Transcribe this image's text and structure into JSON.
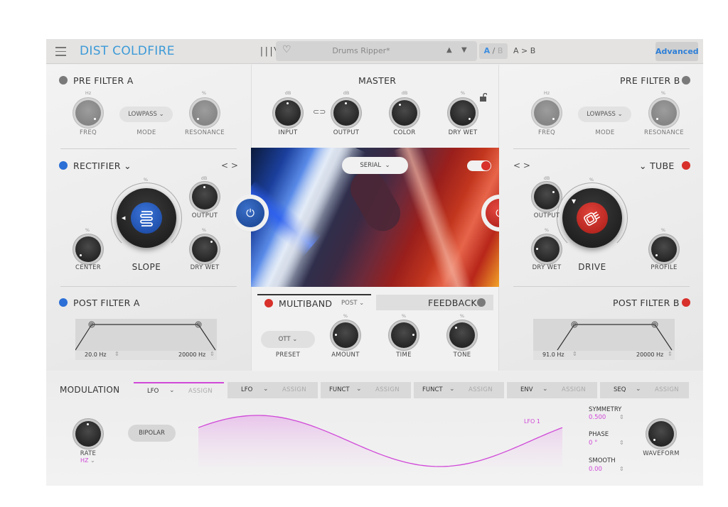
{
  "app": {
    "title": "DIST COLDFIRE"
  },
  "topbar": {
    "library_icon": "|||\\",
    "heart_icon": "♡",
    "preset_name": "Drums Ripper*",
    "prev_icon": "▲",
    "next_icon": "▼",
    "ab": {
      "a": "A",
      "sep": "/",
      "b": "B"
    },
    "a_to_b": "A > B",
    "advanced_label": "Advanced"
  },
  "pre_filter_a": {
    "title": "PRE FILTER A",
    "led": "grey",
    "freq": {
      "unit": "Hz",
      "label": "FREQ"
    },
    "mode": {
      "value": "LOWPASS",
      "label": "MODE"
    },
    "resonance": {
      "unit": "%",
      "label": "RESONANCE"
    }
  },
  "pre_filter_b": {
    "title": "PRE FILTER B",
    "led": "grey",
    "freq": {
      "unit": "Hz",
      "label": "FREQ"
    },
    "mode": {
      "value": "LOWPASS",
      "label": "MODE"
    },
    "resonance": {
      "unit": "%",
      "label": "RESONANCE"
    }
  },
  "master": {
    "title": "MASTER",
    "knobs": [
      {
        "unit": "dB",
        "label": "INPUT"
      },
      {
        "unit": "dB",
        "label": "OUTPUT"
      },
      {
        "unit": "dB",
        "label": "COLOR"
      },
      {
        "unit": "%",
        "label": "DRY  WET"
      }
    ],
    "link_icon": "⊂⊃",
    "lock_icon": "unlocked"
  },
  "dist_a": {
    "type": "RECTIFIER",
    "led": "blue",
    "nav": "< >",
    "slope": {
      "unit": "%",
      "label": "SLOPE"
    },
    "output": {
      "unit": "dB",
      "label": "OUTPUT"
    },
    "center": {
      "unit": "%",
      "label": "CENTER"
    },
    "drywet": {
      "unit": "%",
      "label": "DRY WET"
    }
  },
  "dist_b": {
    "type": "TUBE",
    "led": "red",
    "nav": "< >",
    "drive": {
      "unit": "%",
      "label": "DRIVE"
    },
    "output": {
      "unit": "dB",
      "label": "OUTPUT"
    },
    "drywet": {
      "unit": "%",
      "label": "DRY WET"
    },
    "profile": {
      "unit": "%",
      "label": "PROFILE"
    }
  },
  "routing": {
    "mode": "SERIAL",
    "chevron": "⌄"
  },
  "post_filter_a": {
    "title": "POST FILTER A",
    "led": "blue",
    "low": "20.0 Hz",
    "high": "20000 Hz"
  },
  "post_filter_b": {
    "title": "POST FILTER B",
    "led": "red",
    "low": "91.0 Hz",
    "high": "20000 Hz"
  },
  "multiband": {
    "title": "MULTIBAND",
    "position": "POST",
    "preset": {
      "value": "OTT",
      "label": "PRESET"
    },
    "amount": {
      "unit": "%",
      "label": "AMOUNT"
    },
    "time": {
      "unit": "%",
      "label": "TIME"
    },
    "tone": {
      "unit": "%",
      "label": "TONE"
    }
  },
  "feedback": {
    "title": "FEEDBACK"
  },
  "modulation": {
    "title": "MODULATION",
    "tabs": [
      {
        "type": "LFO",
        "assign": "ASSIGN",
        "active": true
      },
      {
        "type": "LFO",
        "assign": "ASSIGN",
        "active": false
      },
      {
        "type": "FUNCT",
        "assign": "ASSIGN",
        "active": false
      },
      {
        "type": "FUNCT",
        "assign": "ASSIGN",
        "active": false
      },
      {
        "type": "ENV",
        "assign": "ASSIGN",
        "active": false
      },
      {
        "type": "SEQ",
        "assign": "ASSIGN",
        "active": false
      }
    ],
    "rate": {
      "label": "RATE",
      "unit": "HZ"
    },
    "bipolar_label": "BIPOLAR",
    "lfo_name": "LFO 1",
    "symmetry": {
      "label": "SYMMETRY",
      "value": "0.500"
    },
    "phase": {
      "label": "PHASE",
      "value": "0 °"
    },
    "smooth": {
      "label": "SMOOTH",
      "value": "0.00"
    },
    "waveform_label": "WAVEFORM"
  },
  "colors": {
    "accent_blue": "#3d9ad8",
    "dist_a": "#2c6fd6",
    "dist_b": "#d8302a",
    "modulation": "#d048d8"
  }
}
